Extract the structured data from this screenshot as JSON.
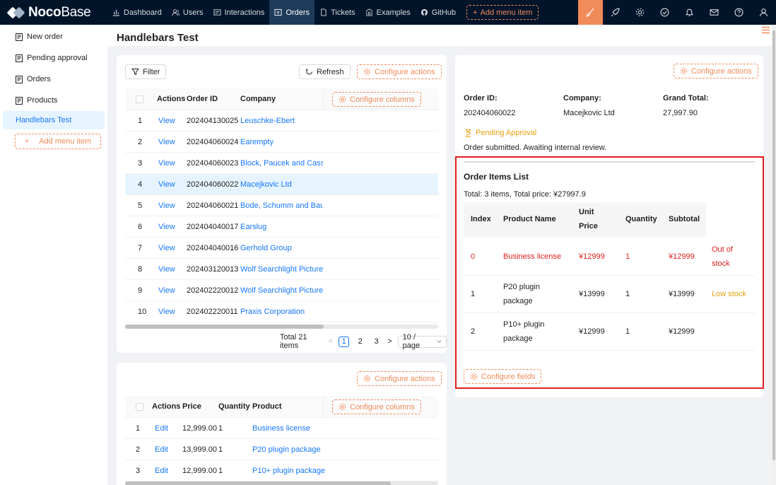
{
  "brand": {
    "name_bold": "Noco",
    "name_light": "Base"
  },
  "topnav": [
    {
      "label": "Dashboard",
      "icon": "bar-chart-icon"
    },
    {
      "label": "Users",
      "icon": "users-icon"
    },
    {
      "label": "Interactions",
      "icon": "interactions-icon"
    },
    {
      "label": "Orders",
      "icon": "orders-icon",
      "active": true
    },
    {
      "label": "Tickets",
      "icon": "tickets-icon"
    },
    {
      "label": "Examples",
      "icon": "bank-icon"
    },
    {
      "label": "GitHub",
      "icon": "github-icon"
    }
  ],
  "top_add_menu": "Add menu item",
  "top_icons": [
    "brush-icon",
    "rocket-icon",
    "gear-icon",
    "check-circle-icon",
    "bell-icon",
    "mail-icon",
    "help-icon",
    "user-icon"
  ],
  "sidebar": {
    "items": [
      {
        "label": "New order"
      },
      {
        "label": "Pending approval"
      },
      {
        "label": "Orders"
      },
      {
        "label": "Products"
      },
      {
        "label": "Handlebars Test",
        "active": true
      }
    ],
    "add_label": "Add menu item"
  },
  "page_title": "Handlebars Test",
  "orders_block": {
    "filter_label": "Filter",
    "refresh_label": "Refresh",
    "configure_actions": "Configure actions",
    "configure_columns": "Configure columns",
    "columns": [
      "Actions",
      "Order ID",
      "Company"
    ],
    "rows": [
      {
        "index": "1",
        "action": "View",
        "order_id": "202404130025",
        "company": "Leuschke-Ebert"
      },
      {
        "index": "2",
        "action": "View",
        "order_id": "202404060024",
        "company": "Earempty"
      },
      {
        "index": "3",
        "action": "View",
        "order_id": "202404060023",
        "company": "Block, Paucek and Cassin"
      },
      {
        "index": "4",
        "action": "View",
        "order_id": "202404060022",
        "company": "Macejkovic Ltd"
      },
      {
        "index": "5",
        "action": "View",
        "order_id": "202404060021",
        "company": "Bode, Schumm and Bauch"
      },
      {
        "index": "6",
        "action": "View",
        "order_id": "202404040017",
        "company": "Earslug"
      },
      {
        "index": "7",
        "action": "View",
        "order_id": "202404040016",
        "company": "Gerhold Group"
      },
      {
        "index": "8",
        "action": "View",
        "order_id": "202403120013",
        "company": "Wolf Searchlight Pictures"
      },
      {
        "index": "9",
        "action": "View",
        "order_id": "202402220012",
        "company": "Wolf Searchlight Pictures"
      },
      {
        "index": "10",
        "action": "View",
        "order_id": "202402220011",
        "company": "Praxis Corporation"
      }
    ],
    "selected_row_index": 3,
    "pagination": {
      "total": "Total 21 items",
      "pages": [
        "1",
        "2",
        "3"
      ],
      "current": "1",
      "page_size": "10 / page",
      "prev": "<",
      "next": ">"
    }
  },
  "items_block": {
    "configure_actions": "Configure actions",
    "configure_columns": "Configure columns",
    "columns": [
      "Actions",
      "Price",
      "Quantity",
      "Product"
    ],
    "rows": [
      {
        "index": "1",
        "action": "Edit",
        "price": "12,999.00",
        "quantity": "1",
        "product": "Business license"
      },
      {
        "index": "2",
        "action": "Edit",
        "price": "13,999.00",
        "quantity": "1",
        "product": "P20 plugin package"
      },
      {
        "index": "3",
        "action": "Edit",
        "price": "12,999.00",
        "quantity": "1",
        "product": "P10+ plugin package"
      }
    ]
  },
  "detail": {
    "configure_actions": "Configure actions",
    "order_id_label": "Order ID:",
    "order_id_value": "202404060022",
    "company_label": "Company:",
    "company_value": "Macejkovic Ltd",
    "grand_total_label": "Grand Total:",
    "grand_total_value": "27,997.90",
    "status": "Pending Approval",
    "status_note": "Order submitted. Awaiting internal review.",
    "list_title": "Order Items List",
    "summary": "Total: 3 items, Total price: ¥27997.9",
    "headers": {
      "index": "Index",
      "product": "Product Name",
      "unit_price_1": "Unit",
      "unit_price_2": "Price",
      "quantity": "Quantity",
      "subtotal": "Subtotal"
    },
    "items": [
      {
        "index": "0",
        "product_1": "Business license",
        "product_2": "",
        "unit_price": "¥12999",
        "quantity": "1",
        "subtotal": "¥12999",
        "stock_1": "Out of",
        "stock_2": "stock",
        "level": "out"
      },
      {
        "index": "1",
        "product_1": "P20 plugin",
        "product_2": "package",
        "unit_price": "¥13999",
        "quantity": "1",
        "subtotal": "¥13999",
        "stock_1": "Low stock",
        "stock_2": "",
        "level": "low"
      },
      {
        "index": "2",
        "product_1": "P10+ plugin",
        "product_2": "package",
        "unit_price": "¥12999",
        "quantity": "1",
        "subtotal": "¥12999",
        "stock_1": "",
        "stock_2": "",
        "level": "ok"
      }
    ],
    "configure_fields": "Configure fields"
  },
  "colors": {
    "accent": "#f18b5a",
    "link": "#1677ff",
    "header_bg": "#00142a",
    "danger": "#e02020",
    "warning": "#e8a10c",
    "highlight_frame": "#e02020"
  }
}
